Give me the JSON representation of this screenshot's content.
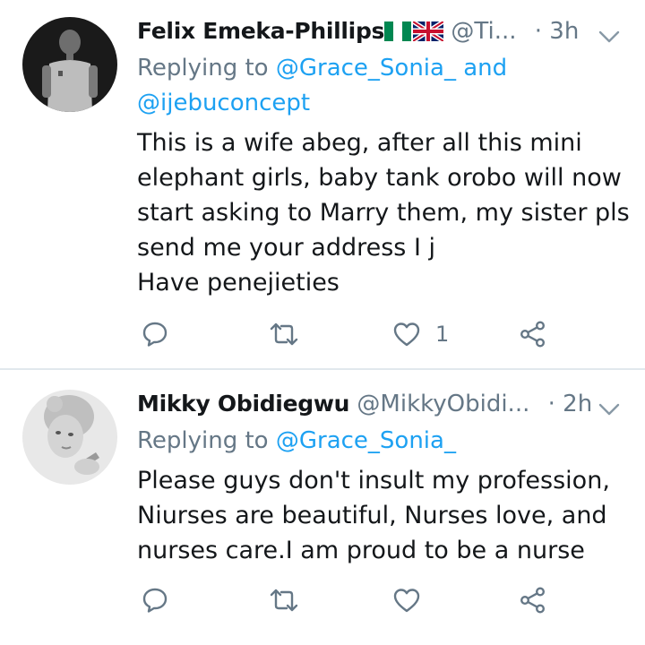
{
  "tweets": [
    {
      "name": "Felix Emeka-Phillips",
      "handle": "@Ti...",
      "separator": "·",
      "time": "3h",
      "replying_prefix": "Replying to ",
      "mention_1": "@Grace_Sonia_",
      "mention_joiner": " and",
      "mention_2": "@ijebuconcept",
      "body_lines": [
        "This is a wife abeg, after all this mini",
        "elephant girls, baby tank orobo will now",
        "start asking to Marry them, my sister pls",
        "send me your address I j",
        "Have penejieties"
      ],
      "like_count": "1",
      "flags": [
        "nigeria-flag-icon",
        "uk-flag-icon"
      ]
    },
    {
      "name": "Mikky Obidiegwu",
      "handle": "@MikkyObidi...",
      "separator": "·",
      "time": "2h",
      "replying_prefix": "Replying to ",
      "mention_1": "@Grace_Sonia_",
      "body_lines": [
        "Please guys don't insult my profession,",
        "Niurses are beautiful, Nurses love, and",
        "nurses care.I am proud to be a nurse"
      ],
      "like_count": ""
    }
  ],
  "colors": {
    "link": "#1da1f2",
    "muted": "#657786",
    "text": "#14171a",
    "divider": "#e1e8ed"
  },
  "icons": [
    "reply-icon",
    "retweet-icon",
    "like-icon",
    "share-icon",
    "chevron-down-icon"
  ]
}
